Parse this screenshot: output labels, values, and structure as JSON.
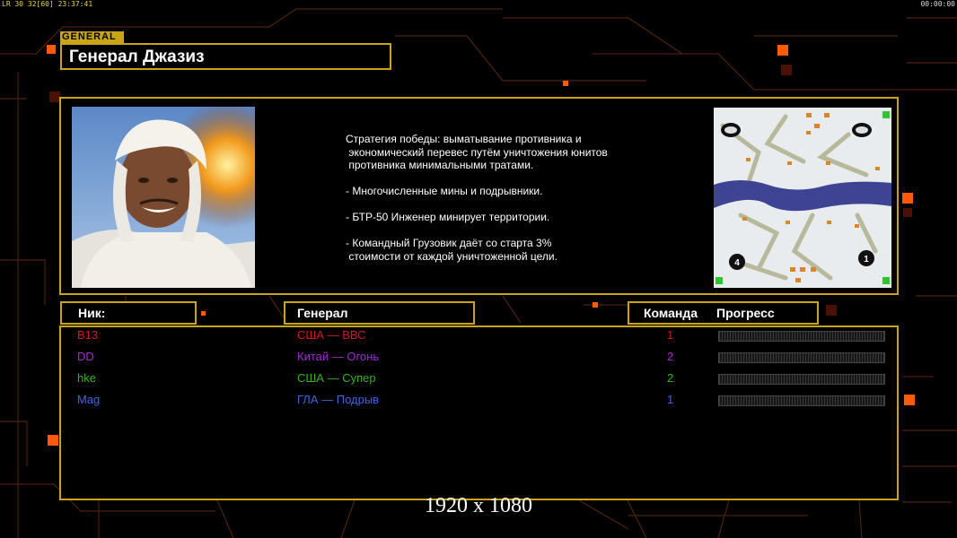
{
  "hud": {
    "left": "LR 30 32[60] 23:37:41",
    "right": "00:00:00"
  },
  "general": {
    "tag": "GENERAL",
    "name": "Генерал Джазиз",
    "description": "Стратегия победы: выматывание противника и\n экономический перевес путём уничтожения юнитов\n противника минимальными тратами.\n\n- Многочисленные мины и подрывники.\n\n- БТР-50 Инженер минирует территории.\n\n- Командный Грузовик даёт со старта 3%\n стоимости от каждой уничтоженной цели."
  },
  "minimap": {
    "start_labels": [
      "4",
      "1"
    ]
  },
  "headers": {
    "nick": "Ник:",
    "general": "Генерал",
    "team": "Команда",
    "progress": "Прогресс"
  },
  "players": [
    {
      "nick": "B13",
      "general": "США — ВВС",
      "team": "1",
      "color": "#d21b1b",
      "progress": 0
    },
    {
      "nick": "DD",
      "general": "Китай — Огонь",
      "team": "2",
      "color": "#9b2fc9",
      "progress": 0
    },
    {
      "nick": "hke",
      "general": "США — Супер",
      "team": "2",
      "color": "#37b31e",
      "progress": 0
    },
    {
      "nick": "Mag",
      "general": "ГЛА — Подрыв",
      "team": "1",
      "color": "#3f66df",
      "progress": 0
    }
  ],
  "resolution_label": "1920 x 1080",
  "colors": {
    "accent": "#c8a416",
    "glow": "#ff5a0a"
  }
}
